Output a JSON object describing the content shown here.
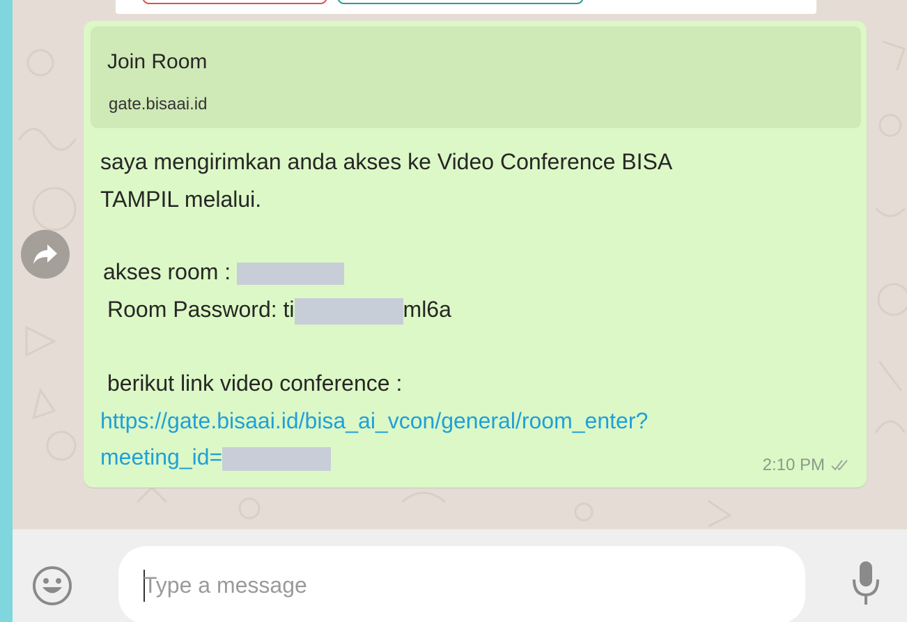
{
  "chat": {
    "preview": {
      "title": "Join Room",
      "domain": "gate.bisaai.id"
    },
    "message": {
      "line1": "saya mengirimkan anda akses ke Video Conference BISA",
      "line2": "TAMPIL melalui.",
      "room_label": " akses room : ",
      "password_label": "Room Password: ti",
      "password_suffix": "ml6a",
      "link_intro": "berikut link video conference :",
      "link_line1": "https://gate.bisaai.id/bisa_ai_vcon/general/room_enter?",
      "link_line2": "meeting_id=",
      "time": "2:10 PM",
      "status_icon": "double-check-icon"
    },
    "colors": {
      "bubble": "#dcf8c6",
      "link": "#1fa0d9",
      "chat_background": "#e5ddd5"
    }
  },
  "composer": {
    "placeholder": "Type a message",
    "value": "",
    "emoji_icon": "smiley-icon",
    "mic_icon": "microphone-icon"
  },
  "side_controls": {
    "forward_icon": "forward-arrow-icon"
  }
}
